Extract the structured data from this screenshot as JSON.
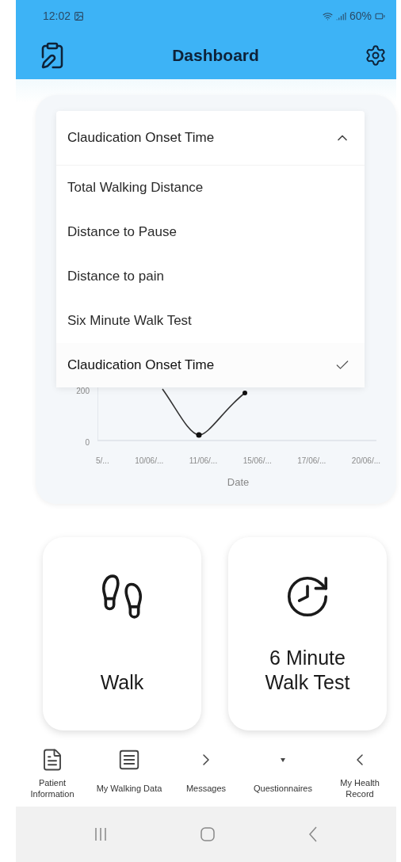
{
  "status_bar": {
    "time": "12:02",
    "battery": "60%"
  },
  "header": {
    "title": "Dashboard"
  },
  "metric_select": {
    "value": "Claudication Onset Time",
    "expanded": true,
    "options": [
      {
        "label": "Total Walking Distance",
        "selected": false
      },
      {
        "label": "Distance to Pause",
        "selected": false
      },
      {
        "label": "Distance to pain",
        "selected": false
      },
      {
        "label": "Six Minute Walk Test",
        "selected": false
      },
      {
        "label": "Claudication Onset Time",
        "selected": true
      }
    ]
  },
  "chart": {
    "yticks": [
      "200",
      "0"
    ],
    "xticks": [
      "5/...",
      "10/06/...",
      "11/06/...",
      "15/06/...",
      "17/06/...",
      "20/06/..."
    ],
    "xlabel": "Date"
  },
  "actions": [
    {
      "label": "Walk",
      "kind": "walk"
    },
    {
      "label": "6 Minute Walk Test",
      "kind": "timer"
    }
  ],
  "bottom_nav": [
    {
      "label": "Patient Information",
      "kind": "document"
    },
    {
      "label": "My Walking Data",
      "kind": "notes"
    },
    {
      "label": "Messages",
      "kind": "chevron-right"
    },
    {
      "label": "Questionnaires",
      "kind": "triangle"
    },
    {
      "label": "My Health Record",
      "kind": "chevron-left"
    }
  ]
}
